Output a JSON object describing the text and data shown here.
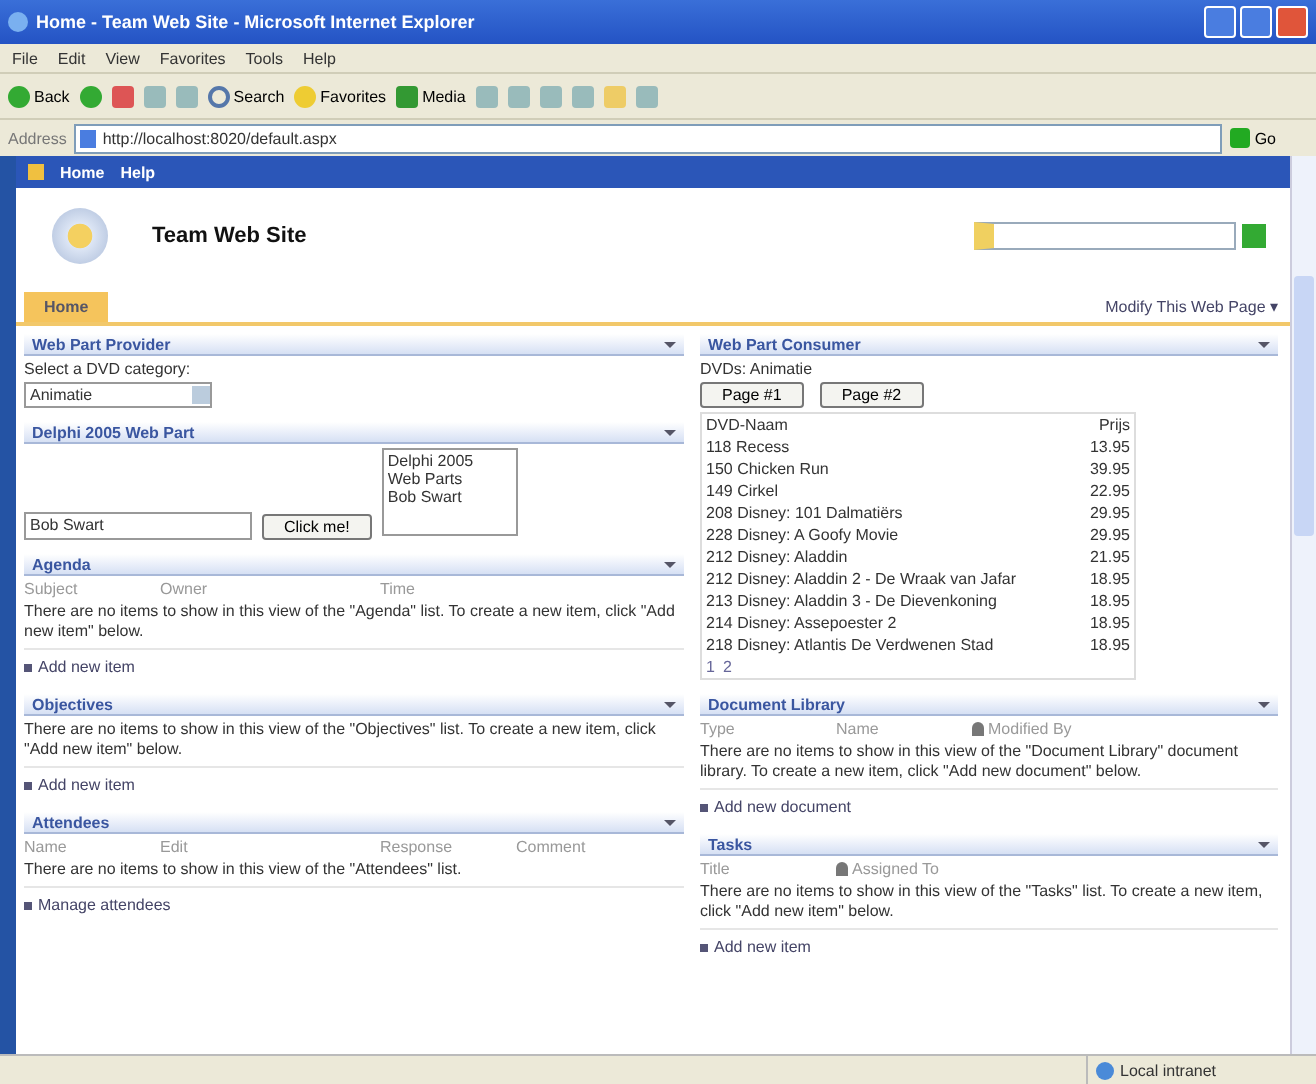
{
  "browser": {
    "title": "Home - Team Web Site - Microsoft Internet Explorer",
    "menu": [
      "File",
      "Edit",
      "View",
      "Favorites",
      "Tools",
      "Help"
    ],
    "toolbar": [
      {
        "kind": "back",
        "label": "Back"
      },
      {
        "kind": "forward"
      },
      {
        "kind": "stop"
      },
      {
        "kind": "refresh"
      },
      {
        "kind": "home"
      },
      {
        "kind": "search",
        "label": "Search"
      },
      {
        "kind": "favorites",
        "label": "Favorites"
      },
      {
        "kind": "media",
        "label": "Media"
      },
      {
        "kind": "history"
      },
      {
        "kind": "mail"
      },
      {
        "kind": "print"
      },
      {
        "kind": "edit"
      },
      {
        "kind": "folder"
      },
      {
        "kind": "discuss"
      }
    ],
    "address_label": "Address",
    "url": "http://localhost:8020/default.aspx",
    "go": "Go"
  },
  "site": {
    "nav": [
      "Home",
      "Help"
    ],
    "title": "Team Web Site",
    "tabs": [
      {
        "label": "Home",
        "selected": true
      }
    ],
    "modify": "Modify This Web Page ▾"
  },
  "left": [
    {
      "kind": "provider",
      "title": "Web Part Provider",
      "prompt": "Select a DVD category:",
      "value": "Animatie"
    },
    {
      "kind": "delphi",
      "title": "Delphi 2005 Web Part",
      "list": [
        "Delphi 2005",
        "Web Parts",
        "Bob Swart"
      ],
      "input": "Bob Swart",
      "button": "Click me!"
    },
    {
      "kind": "list",
      "title": "Agenda",
      "columns": [
        {
          "label": "Subject",
          "person": false
        },
        {
          "label": "Owner",
          "person": false
        },
        {
          "label": "Time",
          "person": false
        }
      ],
      "message": "There are no items to show in this view of the \"Agenda\" list. To create a new item, click \"Add new item\" below.",
      "action": "Add new item"
    },
    {
      "kind": "list",
      "title": "Objectives",
      "message": "There are no items to show in this view of the \"Objectives\" list. To create a new item, click \"Add new item\" below.",
      "action": "Add new item"
    },
    {
      "kind": "list",
      "title": "Attendees",
      "columns": [
        {
          "label": "Name",
          "person": false
        },
        {
          "label": "Edit",
          "person": false
        },
        {
          "label": "Response",
          "person": false
        },
        {
          "label": "Comment",
          "person": false
        }
      ],
      "message": "There are no items to show in this view of the \"Attendees\" list.",
      "action": "Manage attendees"
    }
  ],
  "right": [
    {
      "kind": "consumer",
      "title": "Web Part Consumer",
      "filter_label": "DVDs:",
      "filter_value": "Animatie",
      "buttons": [
        "Page #1",
        "Page #2"
      ],
      "columns": [
        "DVD-Naam",
        "Prijs"
      ],
      "rows": [
        {
          "name": "118  Recess",
          "price": "13.95"
        },
        {
          "name": "150  Chicken Run",
          "price": "39.95"
        },
        {
          "name": "149  Cirkel",
          "price": "22.95"
        },
        {
          "name": "208  Disney: 101 Dalmatiërs",
          "price": "29.95"
        },
        {
          "name": "228  Disney: A Goofy Movie",
          "price": "29.95"
        },
        {
          "name": "212  Disney: Aladdin",
          "price": "21.95"
        },
        {
          "name": "212  Disney: Aladdin 2 - De Wraak van Jafar",
          "price": "18.95"
        },
        {
          "name": "213  Disney: Aladdin 3 - De Dievenkoning",
          "price": "18.95"
        },
        {
          "name": "214  Disney: Assepoester 2",
          "price": "18.95"
        },
        {
          "name": "218  Disney: Atlantis De Verdwenen Stad",
          "price": "18.95"
        }
      ],
      "pager": [
        "1",
        "2"
      ]
    },
    {
      "kind": "list",
      "title": "Document Library",
      "columns": [
        {
          "label": "Type",
          "person": false
        },
        {
          "label": "Name",
          "person": false
        },
        {
          "label": "Modified By",
          "person": true
        }
      ],
      "message": "There are no items to show in this view of the \"Document Library\" document library. To create a new item, click \"Add new document\" below.",
      "action": "Add new document"
    },
    {
      "kind": "list",
      "title": "Tasks",
      "columns": [
        {
          "label": "Title",
          "person": false
        },
        {
          "label": "Assigned To",
          "person": true
        }
      ],
      "message": "There are no items to show in this view of the \"Tasks\" list. To create a new item, click \"Add new item\" below.",
      "action": "Add new item"
    }
  ],
  "status": {
    "zone": "Local intranet"
  }
}
